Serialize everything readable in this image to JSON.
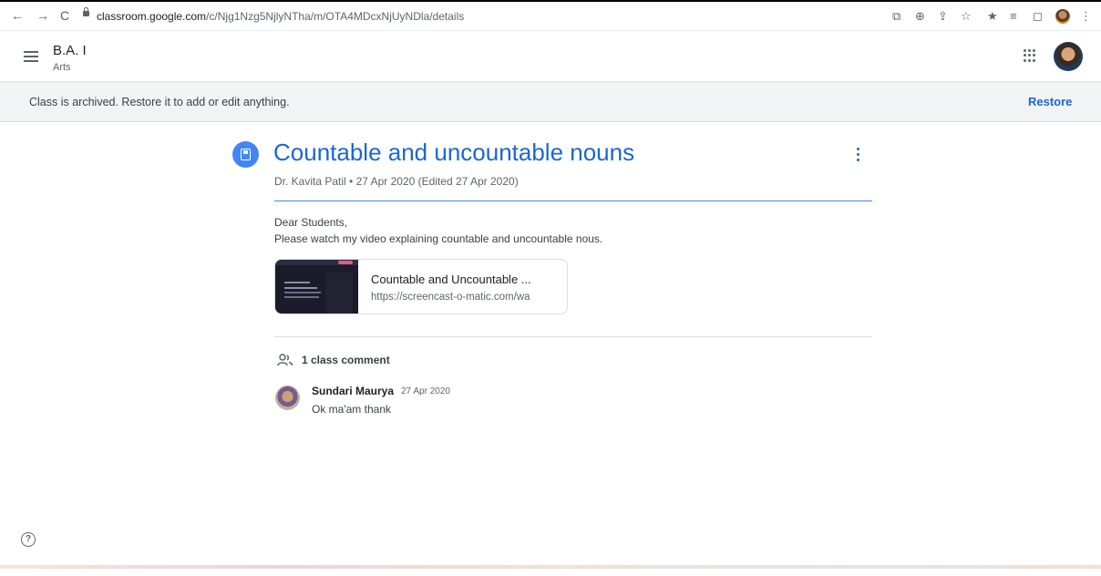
{
  "browser": {
    "url_host": "classroom.google.com",
    "url_path": "/c/Njg1Nzg5NjlyNTha/m/OTA4MDcxNjUyNDla/details",
    "nav": {
      "back": "←",
      "forward": "→",
      "reload": "C"
    },
    "toolbar_icons": [
      "⧉",
      "⊕",
      "⇪",
      "☆",
      "★",
      "≡",
      "◻",
      "⋮"
    ]
  },
  "header": {
    "class_name": "B.A. I",
    "class_section": "Arts"
  },
  "banner": {
    "message": "Class is archived. Restore it to add or edit anything.",
    "restore_label": "Restore"
  },
  "post": {
    "title": "Countable and uncountable nouns",
    "meta": "Dr. Kavita Patil • 27 Apr 2020 (Edited 27 Apr 2020)",
    "body_line1": "Dear Students,",
    "body_line2": "Please watch my video explaining countable and uncountable nous.",
    "attachment": {
      "title": "Countable and Uncountable ...",
      "url": "https://screencast-o-matic.com/wa"
    }
  },
  "comments": {
    "count_label": "1 class comment",
    "items": [
      {
        "author": "Sundari Maurya",
        "date": "27 Apr 2020",
        "text": "Ok ma'am thank"
      }
    ]
  },
  "help": {
    "symbol": "?"
  },
  "colors": {
    "accent": "#1967d2",
    "banner_bg": "#f1f3f4",
    "icon_blue": "#4285f4"
  }
}
